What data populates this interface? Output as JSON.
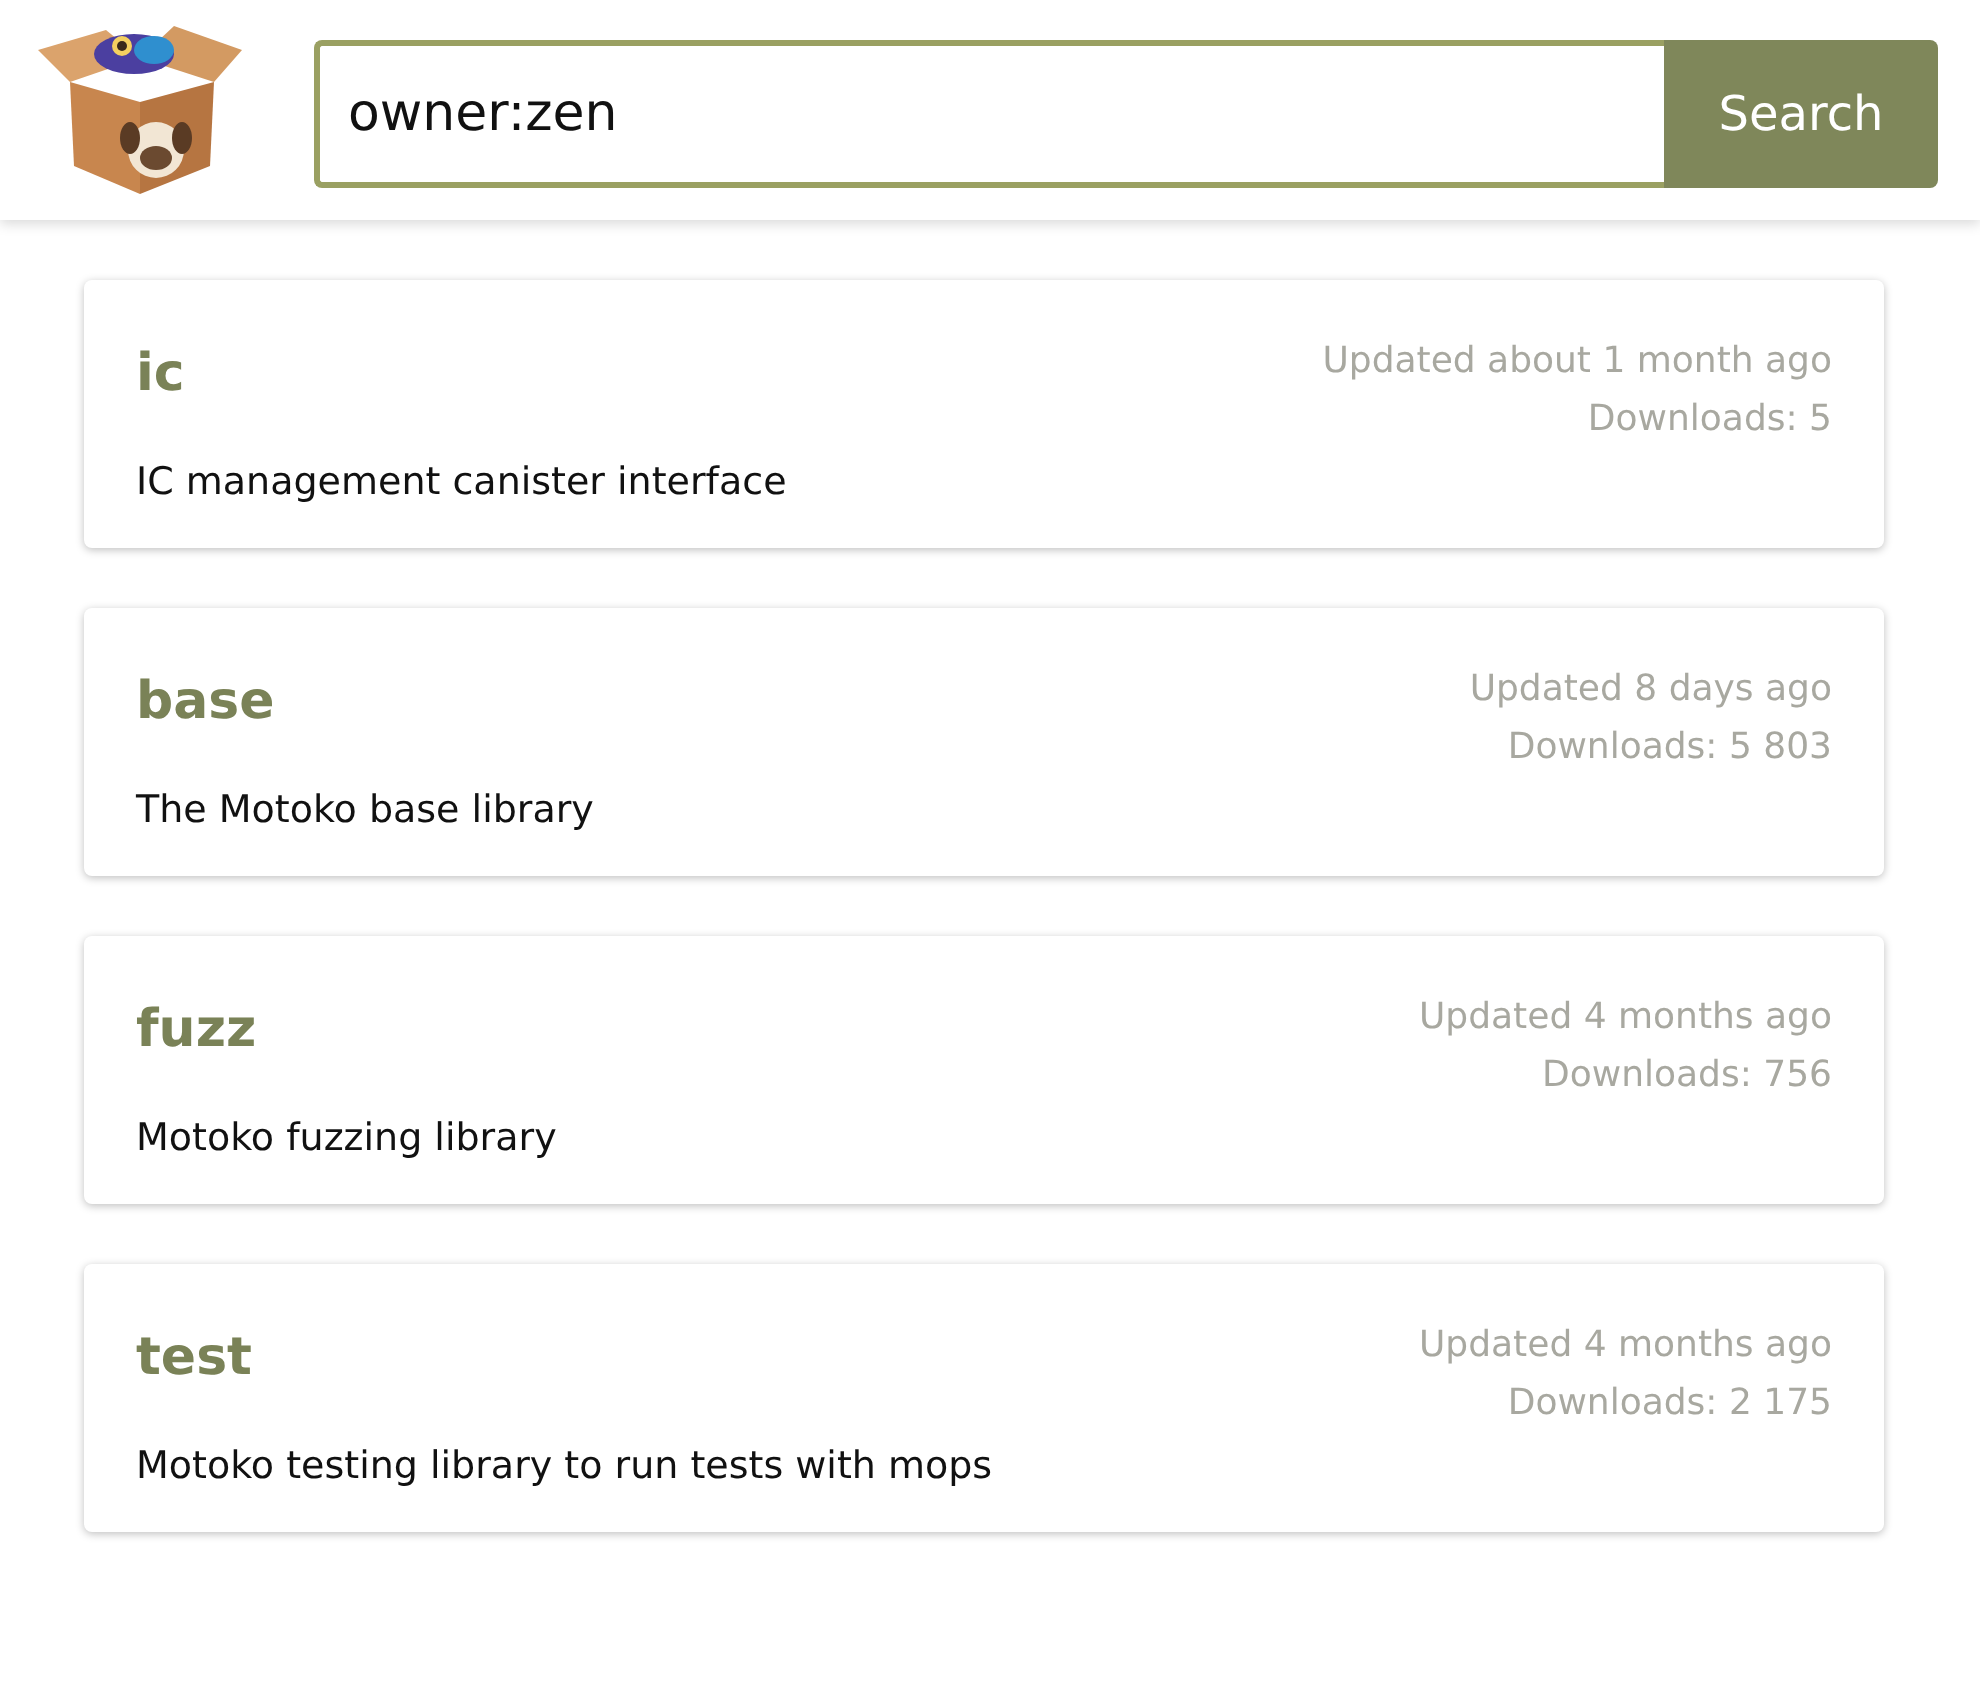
{
  "search": {
    "value": "owner:zen",
    "button": "Search"
  },
  "packages": [
    {
      "name": "ic",
      "updated": "Updated about 1 month ago",
      "downloads": "Downloads: 5",
      "description": "IC management canister interface"
    },
    {
      "name": "base",
      "updated": "Updated 8 days ago",
      "downloads": "Downloads: 5 803",
      "description": "The Motoko base library"
    },
    {
      "name": "fuzz",
      "updated": "Updated 4 months ago",
      "downloads": "Downloads: 756",
      "description": "Motoko fuzzing library"
    },
    {
      "name": "test",
      "updated": "Updated 4 months ago",
      "downloads": "Downloads: 2 175",
      "description": "Motoko testing library to run tests with mops"
    }
  ]
}
